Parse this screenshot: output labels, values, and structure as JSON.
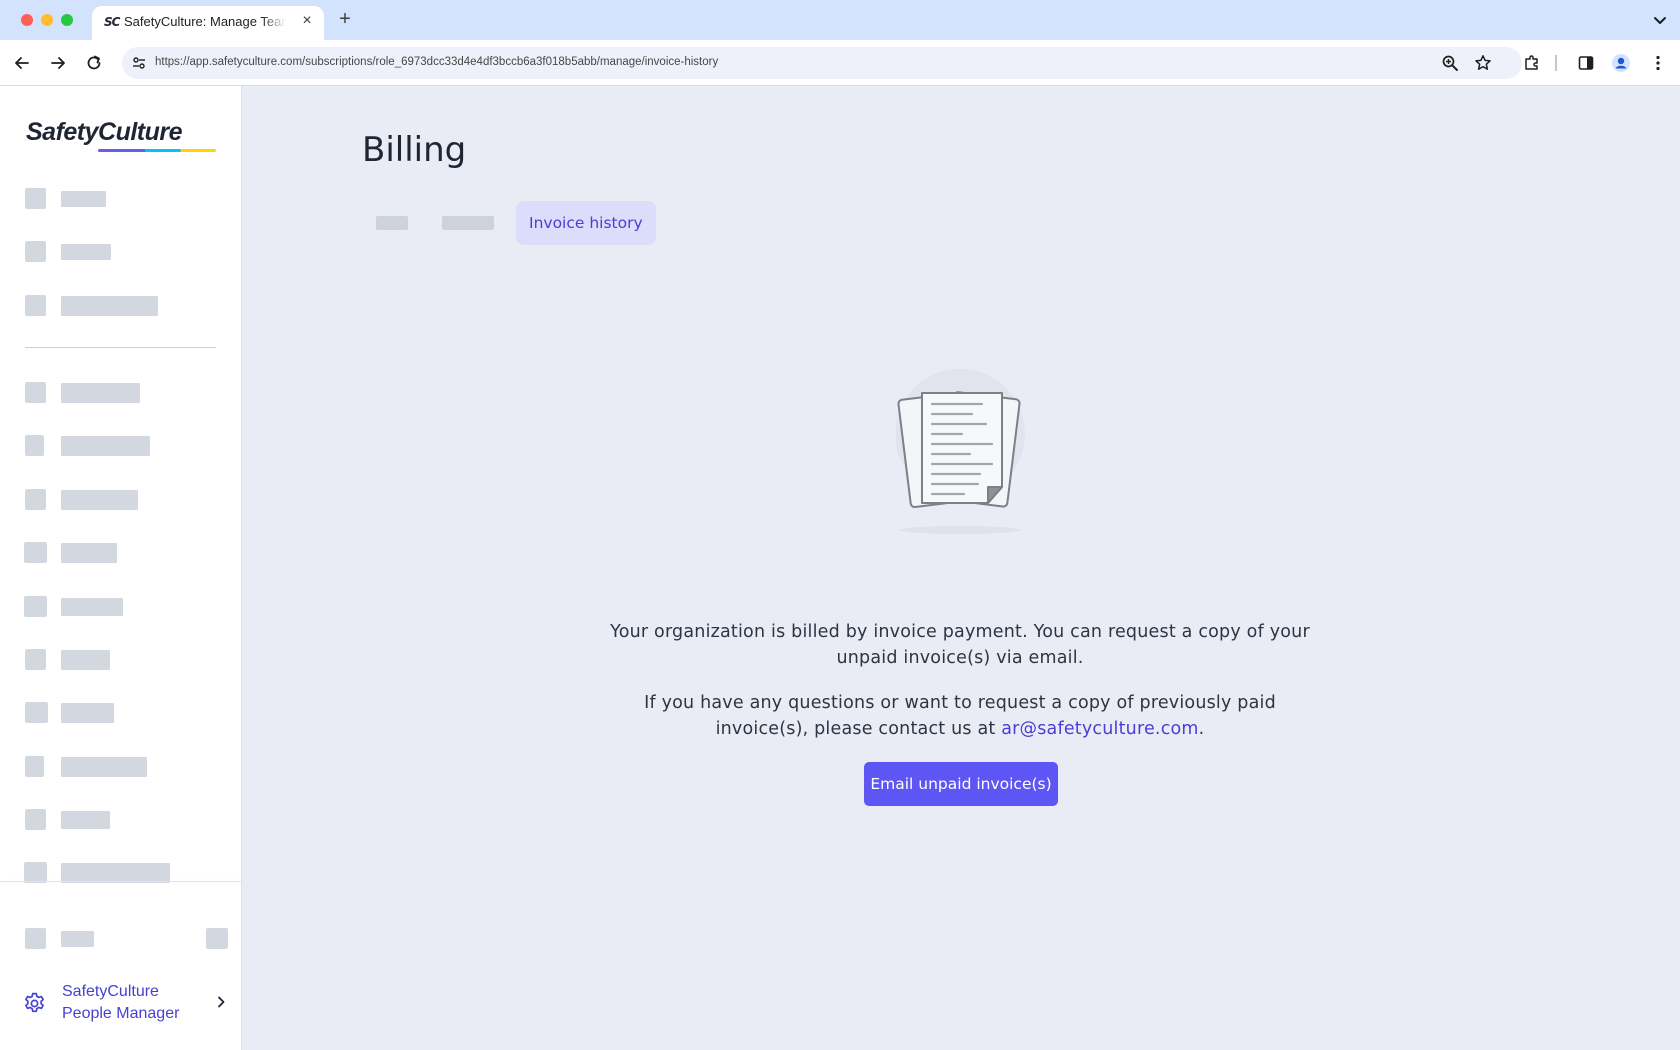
{
  "browser": {
    "tab_favicon": "SC",
    "tab_title": "SafetyCulture: Manage Teams",
    "url": "https://app.safetyculture.com/subscriptions/role_6973dcc33d4e4df3bccb6a3f018b5abb/manage/invoice-history"
  },
  "sidebar": {
    "logo_text": "SafetyCulture",
    "bottom_link": {
      "line1": "SafetyCulture",
      "line2": "People Manager"
    }
  },
  "main": {
    "page_title": "Billing",
    "tabs": [
      {
        "label": "",
        "loading": true
      },
      {
        "label": "",
        "loading": true
      },
      {
        "label": "Invoice history",
        "active": true
      }
    ],
    "message_line1a": "Your organization is billed by invoice payment. You can request a copy of your",
    "message_line1b": "unpaid invoice(s) via email.",
    "message_line2a": "If you have any questions or want to request a copy of previously paid",
    "message_line2b": "invoice(s), please contact us at",
    "contact_email": "ar@safetyculture.com",
    "message_line2_end": ".",
    "cta_label": "Email unpaid invoice(s)"
  },
  "colors": {
    "accent": "#5e55f5",
    "link": "#4740d4",
    "page_bg": "#e9ecf5",
    "skeleton": "#d3d7e0"
  }
}
